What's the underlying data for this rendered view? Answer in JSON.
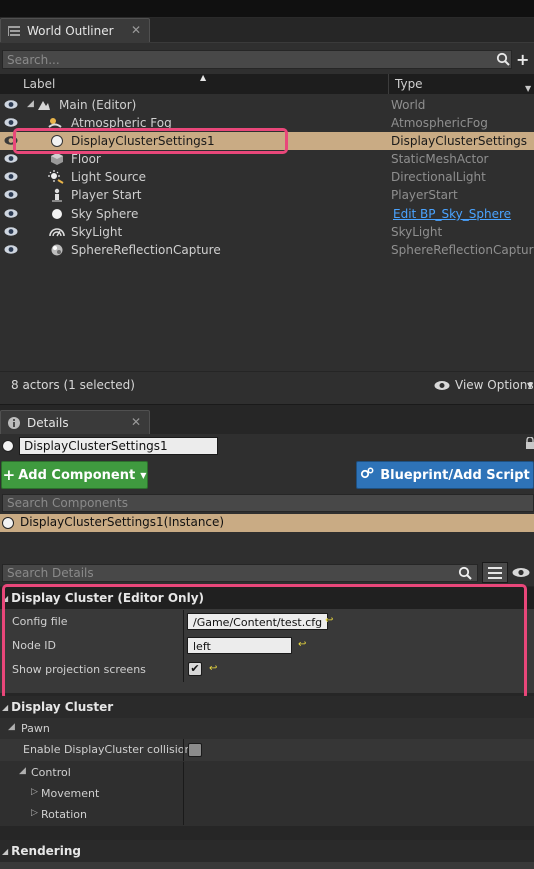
{
  "outliner": {
    "tab_title": "World Outliner",
    "tab_close": "✕",
    "search_placeholder": "Search...",
    "columns": {
      "label": "Label",
      "type": "Type"
    },
    "rows": [
      {
        "label": "Main (Editor)",
        "type": "World",
        "icon": "world-icon"
      },
      {
        "label": "Atmospheric Fog",
        "type": "AtmosphericFog",
        "icon": "fog-icon"
      },
      {
        "label": "DisplayClusterSettings1",
        "type": "DisplayClusterSettings",
        "icon": "sphere-icon",
        "selected": true
      },
      {
        "label": "Floor",
        "type": "StaticMeshActor",
        "icon": "mesh-icon"
      },
      {
        "label": "Light Source",
        "type": "DirectionalLight",
        "icon": "sun-icon"
      },
      {
        "label": "Player Start",
        "type": "PlayerStart",
        "icon": "player-start-icon"
      },
      {
        "label": "Sky Sphere",
        "type": "Edit BP_Sky_Sphere",
        "icon": "sphere-icon",
        "type_is_link": true
      },
      {
        "label": "SkyLight",
        "type": "SkyLight",
        "icon": "skylight-icon"
      },
      {
        "label": "SphereReflectionCapture",
        "type": "SphereReflectionCapture",
        "icon": "reflection-icon"
      }
    ],
    "status": "8 actors (1 selected)",
    "view_options": "View Options"
  },
  "details": {
    "tab_title": "Details",
    "tab_close": "✕",
    "actor_name": "DisplayClusterSettings1",
    "add_component": "Add Component",
    "blueprint_button": "Blueprint/Add Script",
    "search_components_placeholder": "Search Components",
    "component_instance": "DisplayClusterSettings1(Instance)",
    "search_details_placeholder": "Search Details",
    "section_editor_only": {
      "title": "Display Cluster (Editor Only)",
      "config_file_label": "Config file",
      "config_file_value": "/Game/Content/test.cfg",
      "node_id_label": "Node ID",
      "node_id_value": "left",
      "show_projection_label": "Show projection screens",
      "show_projection_checked": true
    },
    "section_display_cluster": {
      "title": "Display Cluster",
      "pawn": "Pawn",
      "enable_collisions_label": "Enable DisplayCluster collisions",
      "enable_collisions_checked": false,
      "control": "Control",
      "movement": "Movement",
      "rotation": "Rotation"
    },
    "section_rendering": {
      "title": "Rendering"
    }
  },
  "colors": {
    "highlight": "#e9477a",
    "selected_row": "#c9ab84",
    "add_component": "#3f9a3f",
    "blueprint": "#2e73b8",
    "link": "#4aa3ff"
  }
}
